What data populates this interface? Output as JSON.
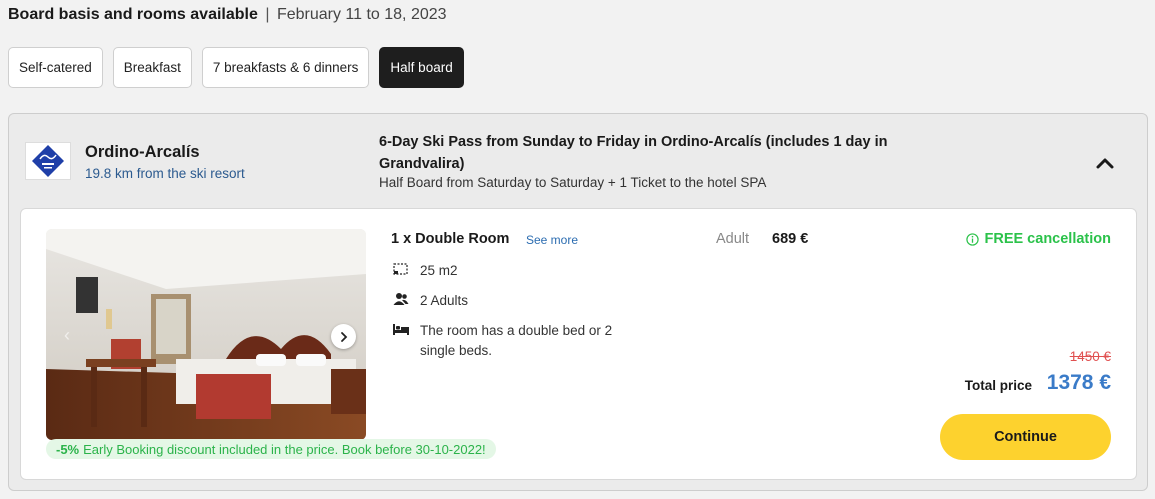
{
  "header": {
    "title": "Board basis and rooms available",
    "separator": "|",
    "dates": "February 11 to 18, 2023"
  },
  "board_options": [
    {
      "label": "Self-catered",
      "active": false
    },
    {
      "label": "Breakfast",
      "active": false
    },
    {
      "label": "7 breakfasts & 6 dinners",
      "active": false
    },
    {
      "label": "Half board",
      "active": true
    }
  ],
  "hotel": {
    "name": "Ordino-Arcalís",
    "distance": "19.8 km from the ski resort",
    "logo_color": "#1f3fa8"
  },
  "package": {
    "title_bold": "6-Day Ski Pass from Sunday to Friday in Ordino-Arcalís",
    "title_extra": "(includes 1 day in Grandvalira)",
    "subtitle": "Half Board from Saturday to Saturday + 1 Ticket to the hotel SPA"
  },
  "room": {
    "title": "1 x Double Room",
    "see_more": "See more",
    "size": "25 m2",
    "occupancy": "2 Adults",
    "beds": "The room has a double bed or 2 single beds.",
    "adult_label": "Adult",
    "adult_price": "689 €",
    "cancellation": "FREE cancellation",
    "old_price": "1450 €",
    "total_label": "Total price",
    "total_price": "1378 €",
    "continue_label": "Continue"
  },
  "promo": {
    "percent": "-5%",
    "text": "Early Booking discount included in the price. Book before 30-10-2022!"
  },
  "colors": {
    "accent_blue": "#3a7bc8",
    "green": "#2bc24a",
    "cta_yellow": "#fdd22e",
    "strike_red": "#e05050"
  }
}
